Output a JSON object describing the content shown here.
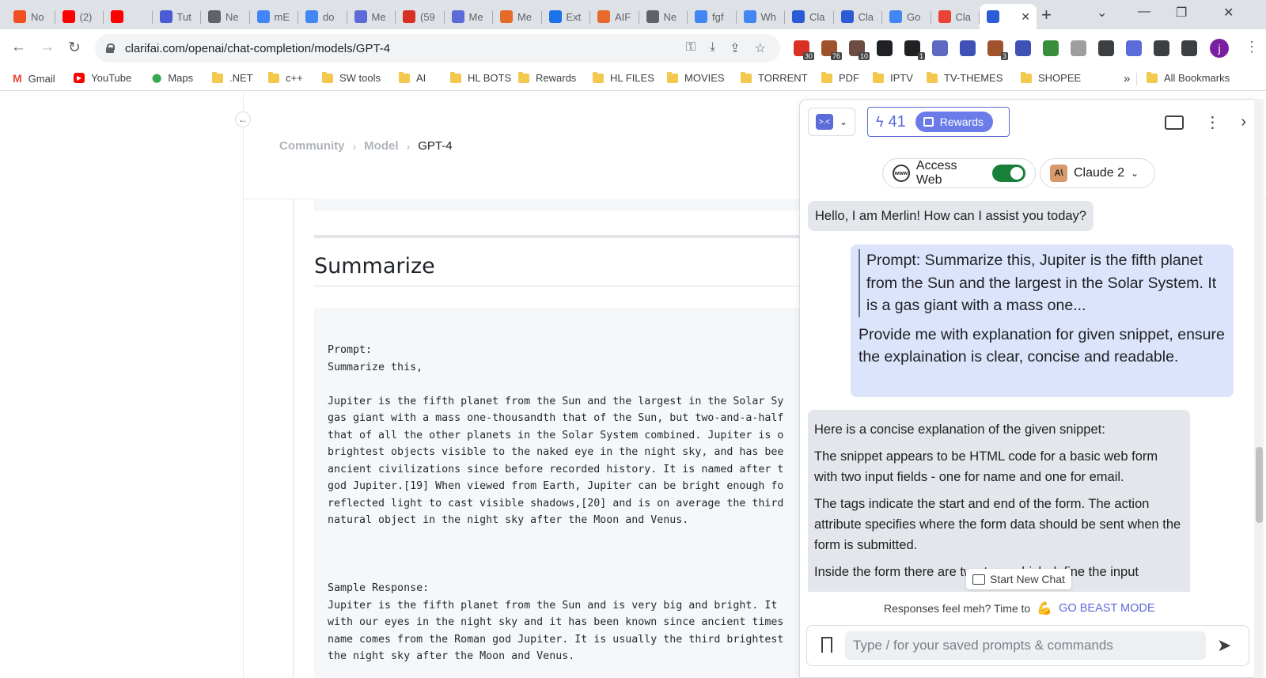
{
  "browser": {
    "tabs": [
      {
        "label": "No",
        "icon": "microsoft-icon",
        "color": "#f25022"
      },
      {
        "label": "(2)",
        "icon": "youtube-icon",
        "color": "#ff0000"
      },
      {
        "label": "",
        "icon": "youtube-icon",
        "color": "#ff0000"
      },
      {
        "label": "Tut",
        "icon": "brave-icon",
        "color": "#4a5bd4"
      },
      {
        "label": "Ne",
        "icon": "chrome-icon",
        "color": "#5f6368"
      },
      {
        "label": "mE",
        "icon": "google-icon",
        "color": "#4285f4"
      },
      {
        "label": "do",
        "icon": "google-icon",
        "color": "#4285f4"
      },
      {
        "label": "Me",
        "icon": "merlin-icon",
        "color": "#5b6bd8"
      },
      {
        "label": "(59",
        "icon": "badge-icon",
        "color": "#d93025"
      },
      {
        "label": "Me",
        "icon": "merlin-icon",
        "color": "#5b6bd8"
      },
      {
        "label": "Me",
        "icon": "arc-icon",
        "color": "#e66b2b"
      },
      {
        "label": "Ext",
        "icon": "puzzle-icon",
        "color": "#1a73e8"
      },
      {
        "label": "AIF",
        "icon": "arc-icon",
        "color": "#e66b2b"
      },
      {
        "label": "Ne",
        "icon": "chrome-icon",
        "color": "#5f6368"
      },
      {
        "label": "fgf",
        "icon": "google-icon",
        "color": "#4285f4"
      },
      {
        "label": "Wh",
        "icon": "google-icon",
        "color": "#4285f4"
      },
      {
        "label": "Cla",
        "icon": "clarifai-icon",
        "color": "#2c5bd6"
      },
      {
        "label": "Cla",
        "icon": "clarifai-icon",
        "color": "#2c5bd6"
      },
      {
        "label": "Go",
        "icon": "google-icon",
        "color": "#4285f4"
      },
      {
        "label": "Cla",
        "icon": "gmail-icon",
        "color": "#ea4335"
      },
      {
        "label": "",
        "icon": "clarifai-icon",
        "color": "#2c5bd6"
      }
    ],
    "url": "clarifai.com/openai/chat-completion/models/GPT-4",
    "extensions": [
      {
        "icon": "ext-red-icon",
        "badge": "30",
        "color": "#d93025"
      },
      {
        "icon": "ext-orange-icon",
        "badge": "76",
        "color": "#a0522d"
      },
      {
        "icon": "ext-stop-icon",
        "badge": "10",
        "color": "#6d4c41"
      },
      {
        "icon": "ext-grid-icon",
        "badge": "",
        "color": "#202124"
      },
      {
        "icon": "ext-black-icon",
        "badge": "1",
        "color": "#202124"
      },
      {
        "icon": "ext-pen-icon",
        "badge": "",
        "color": "#5c6bc0"
      },
      {
        "icon": "ext-circle-icon",
        "badge": "",
        "color": "#3f51b5"
      },
      {
        "icon": "ext-cookie-icon",
        "badge": "3",
        "color": "#a0522d"
      },
      {
        "icon": "ext-save-icon",
        "badge": "",
        "color": "#3f51b5"
      },
      {
        "icon": "ext-globe-icon",
        "badge": "",
        "color": "#388e3c"
      },
      {
        "icon": "ext-dot-icon",
        "badge": "",
        "color": "#9e9e9e"
      },
      {
        "icon": "ext-reader-icon",
        "badge": "",
        "color": "#3c4043"
      },
      {
        "icon": "ext-merlin-icon",
        "badge": "",
        "color": "#5b6bd8"
      },
      {
        "icon": "puzzle-icon",
        "badge": "",
        "color": "#3c4043"
      },
      {
        "icon": "sidepanel-icon",
        "badge": "",
        "color": "#3c4043"
      }
    ],
    "profile_initial": "j"
  },
  "bookmarks": [
    {
      "label": "Gmail",
      "type": "gmail"
    },
    {
      "label": "YouTube",
      "type": "youtube"
    },
    {
      "label": "Maps",
      "type": "maps"
    },
    {
      "label": ".NET",
      "type": "folder"
    },
    {
      "label": "c++",
      "type": "folder"
    },
    {
      "label": "SW tools",
      "type": "folder"
    },
    {
      "label": "AI",
      "type": "folder"
    },
    {
      "label": "HL BOTS",
      "type": "folder"
    },
    {
      "label": "Rewards",
      "type": "folder"
    },
    {
      "label": "HL FILES",
      "type": "folder"
    },
    {
      "label": "MOVIES",
      "type": "folder"
    },
    {
      "label": "TORRENT",
      "type": "folder"
    },
    {
      "label": "PDF",
      "type": "folder"
    },
    {
      "label": "IPTV",
      "type": "folder"
    },
    {
      "label": "TV-THEMES",
      "type": "folder"
    },
    {
      "label": "SHOPEE",
      "type": "folder"
    }
  ],
  "bookmarks_overflow": "»",
  "all_bookmarks": "All Bookmarks",
  "page": {
    "breadcrumb": [
      "Community",
      "Model",
      "GPT-4"
    ],
    "heading": "Summarize",
    "code_lines": [
      "",
      "",
      "Prompt:",
      "Summarize this,",
      "",
      "Jupiter is the fifth planet from the Sun and the largest in the Solar Sy",
      "gas giant with a mass one-thousandth that of the Sun, but two-and-a-half",
      "that of all the other planets in the Solar System combined. Jupiter is o",
      "brightest objects visible to the naked eye in the night sky, and has bee",
      "ancient civilizations since before recorded history. It is named after t",
      "god Jupiter.[19] When viewed from Earth, Jupiter can be bright enough fo",
      "reflected light to cast visible shadows,[20] and is on average the third",
      "natural object in the night sky after the Moon and Venus.",
      "",
      "",
      "",
      "Sample Response:",
      "Jupiter is the fifth planet from the Sun and is very big and bright. It",
      "with our eyes in the night sky and it has been known since ancient times",
      "name comes from the Roman god Jupiter. It is usually the third brightest",
      "the night sky after the Moon and Venus."
    ]
  },
  "merlin": {
    "credits": "41",
    "rewards_label": "Rewards",
    "access_web_label": "Access Web",
    "access_web_on": true,
    "model_label": "Claude 2",
    "greeting": "Hello, I am Merlin! How can I assist you today?",
    "user_quote": "Prompt: Summarize this, Jupiter is the fifth planet from the Sun and the largest in the Solar System. It is a gas giant with a mass one...",
    "user_ask": "Provide me with explanation for given snippet, ensure the explaination is clear, concise and readable.",
    "reply_paragraphs": [
      "Here is a concise explanation of the given snippet:",
      "The snippet appears to be HTML code for a basic web form with two input fields - one for name and one for email.",
      "The tags indicate the start and end of the form. The action attribute specifies where the form data should be sent when the form is submitted.",
      "Inside the form there are two tags which define the input"
    ],
    "new_chat_label": "Start New Chat",
    "beast_prompt": "Responses feel meh? Time to",
    "beast_link": "GO BEAST MODE",
    "input_placeholder": "Type / for your saved prompts & commands",
    "accent": "#5b6bd8"
  }
}
